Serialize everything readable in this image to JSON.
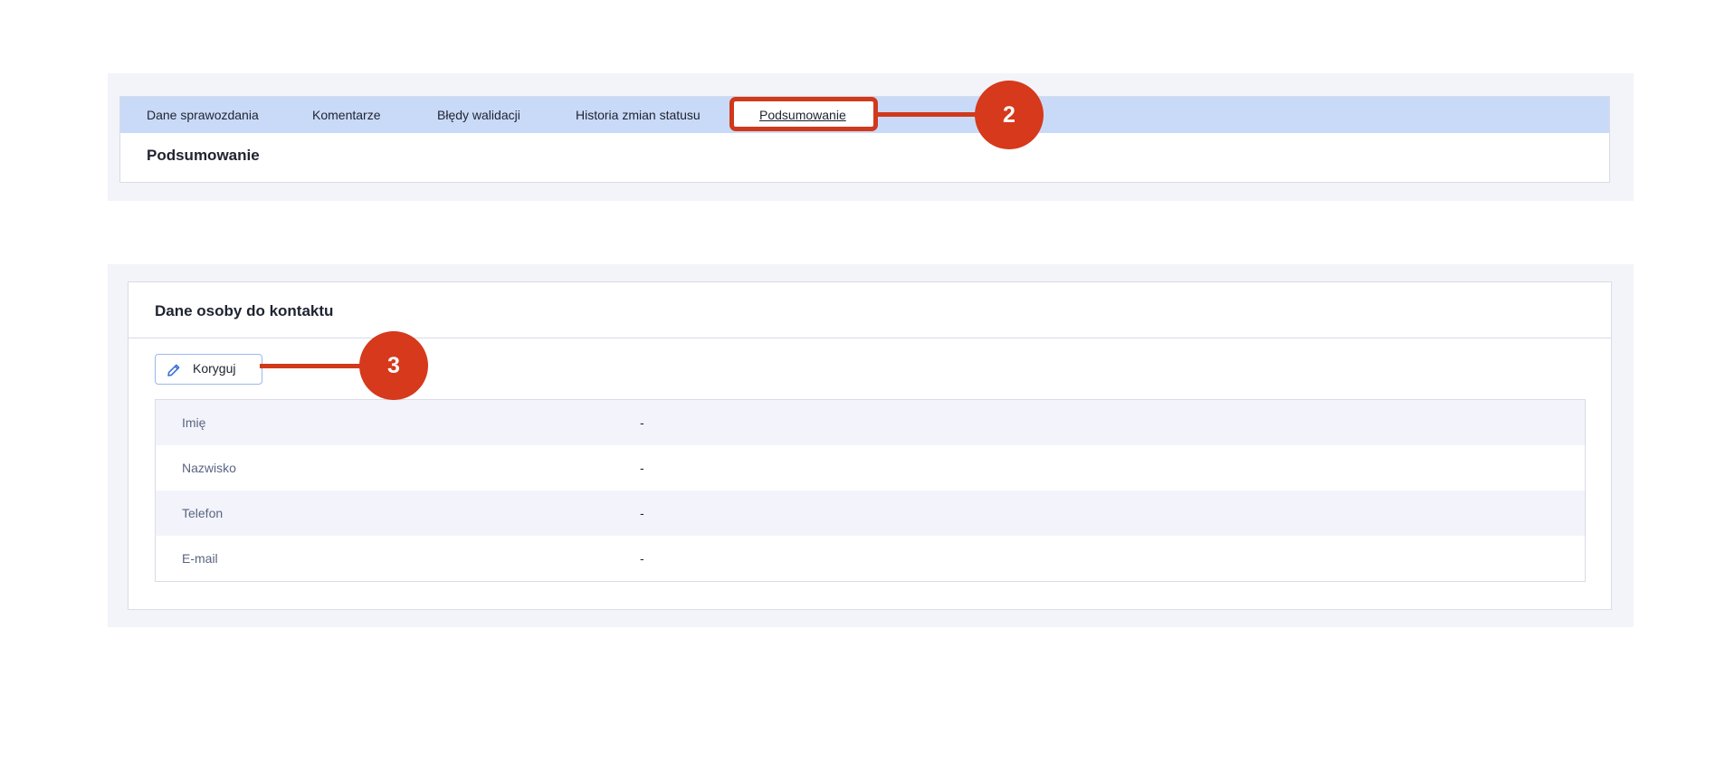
{
  "tabs": [
    {
      "label": "Dane sprawozdania",
      "active": false
    },
    {
      "label": "Komentarze",
      "active": false
    },
    {
      "label": "Błędy walidacji",
      "active": false
    },
    {
      "label": "Historia zmian statusu",
      "active": false
    },
    {
      "label": "Podsumowanie",
      "active": true
    }
  ],
  "summary": {
    "title": "Podsumowanie"
  },
  "contact": {
    "title": "Dane osoby do kontaktu",
    "edit_button": {
      "label": "Koryguj",
      "icon": "pencil-icon"
    },
    "rows": [
      {
        "label": "Imię",
        "value": "-"
      },
      {
        "label": "Nazwisko",
        "value": "-"
      },
      {
        "label": "Telefon",
        "value": "-"
      },
      {
        "label": "E-mail",
        "value": "-"
      }
    ]
  },
  "annotations": [
    {
      "number": "2"
    },
    {
      "number": "3"
    }
  ],
  "colors": {
    "tab_bar": "#c9daf8",
    "panel_background": "#f3f4f9",
    "annotation_red": "#d0391c",
    "button_border": "#9bb8ea",
    "icon_blue": "#3a6fd8"
  }
}
